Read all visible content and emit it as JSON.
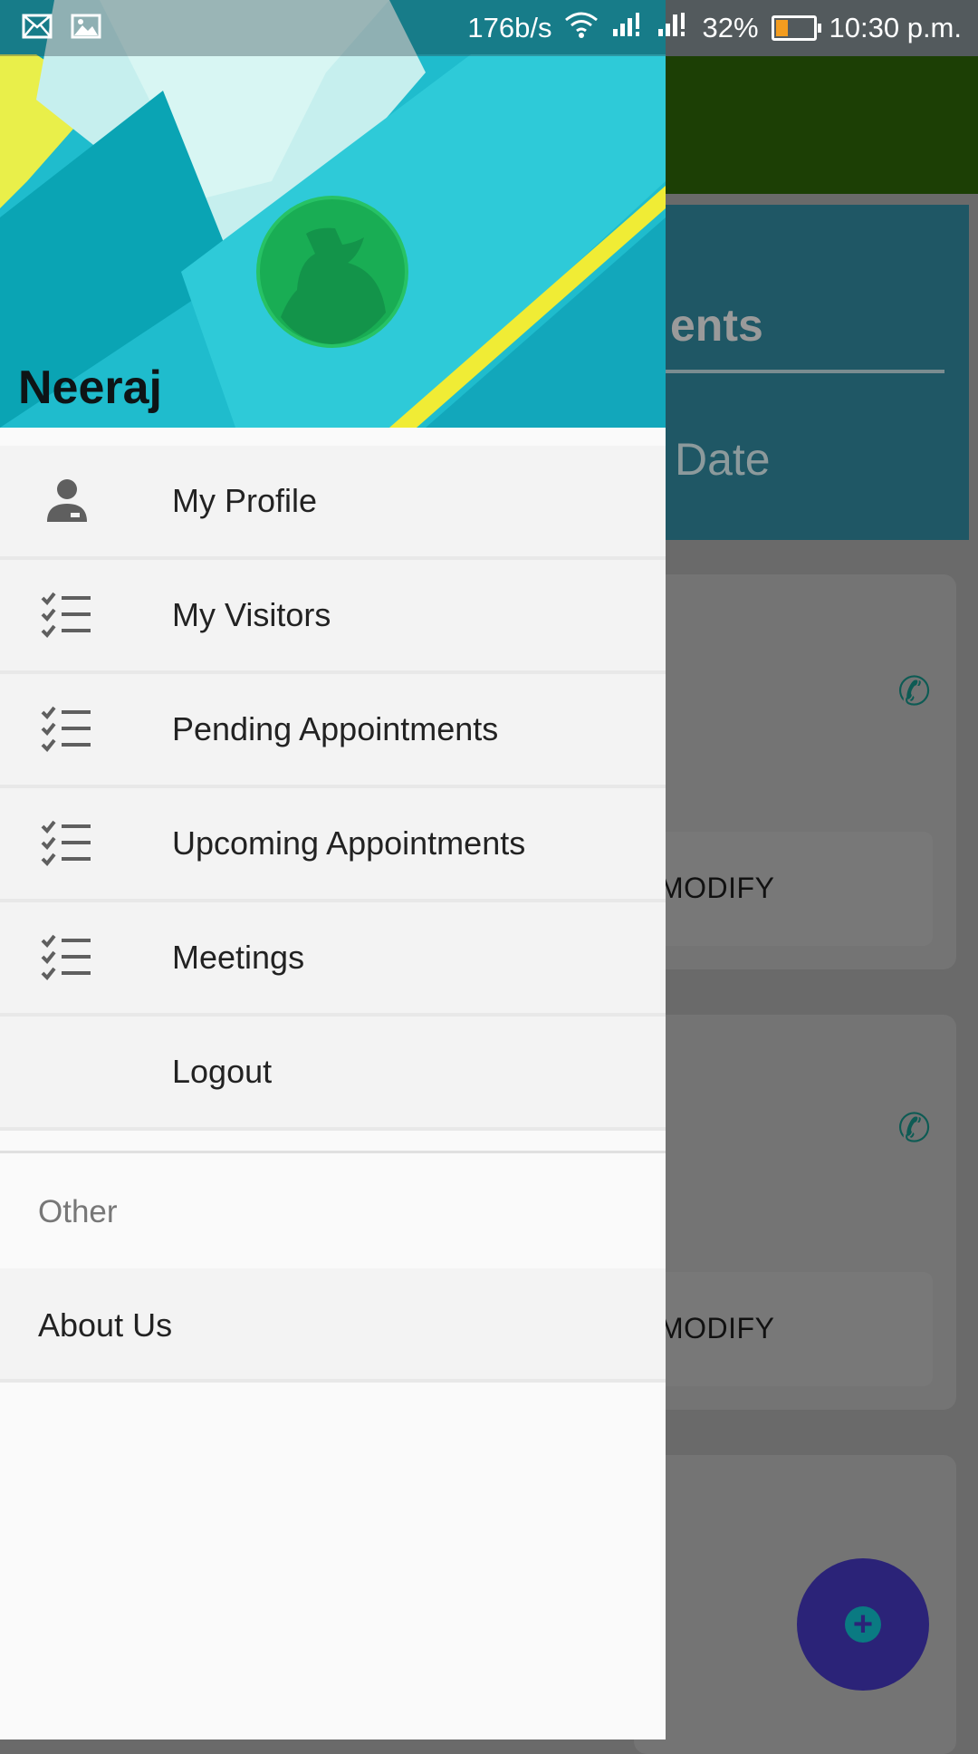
{
  "status_bar": {
    "net_speed": "176b/s",
    "battery": "32%",
    "time": "10:30 p.m.",
    "battery_level": 0.32
  },
  "background_screen": {
    "title_partial": "ents",
    "date_partial": "Date",
    "cards": [
      {
        "action": "MODIFY"
      },
      {
        "action": "MODIFY"
      }
    ]
  },
  "drawer": {
    "user_name": "Neeraj",
    "menu_items": [
      {
        "label": "My Profile",
        "icon": "person-icon"
      },
      {
        "label": "My Visitors",
        "icon": "checklist-icon"
      },
      {
        "label": "Pending Appointments",
        "icon": "checklist-icon"
      },
      {
        "label": "Upcoming Appointments",
        "icon": "checklist-icon"
      },
      {
        "label": "Meetings",
        "icon": "checklist-icon"
      },
      {
        "label": "Logout",
        "icon": ""
      }
    ],
    "section_title": "Other",
    "other_items": [
      {
        "label": "About Us"
      }
    ]
  },
  "colors": {
    "accent_green": "#16a74a",
    "header_cyan": "#22b8c8",
    "fab": "#2b2378"
  }
}
